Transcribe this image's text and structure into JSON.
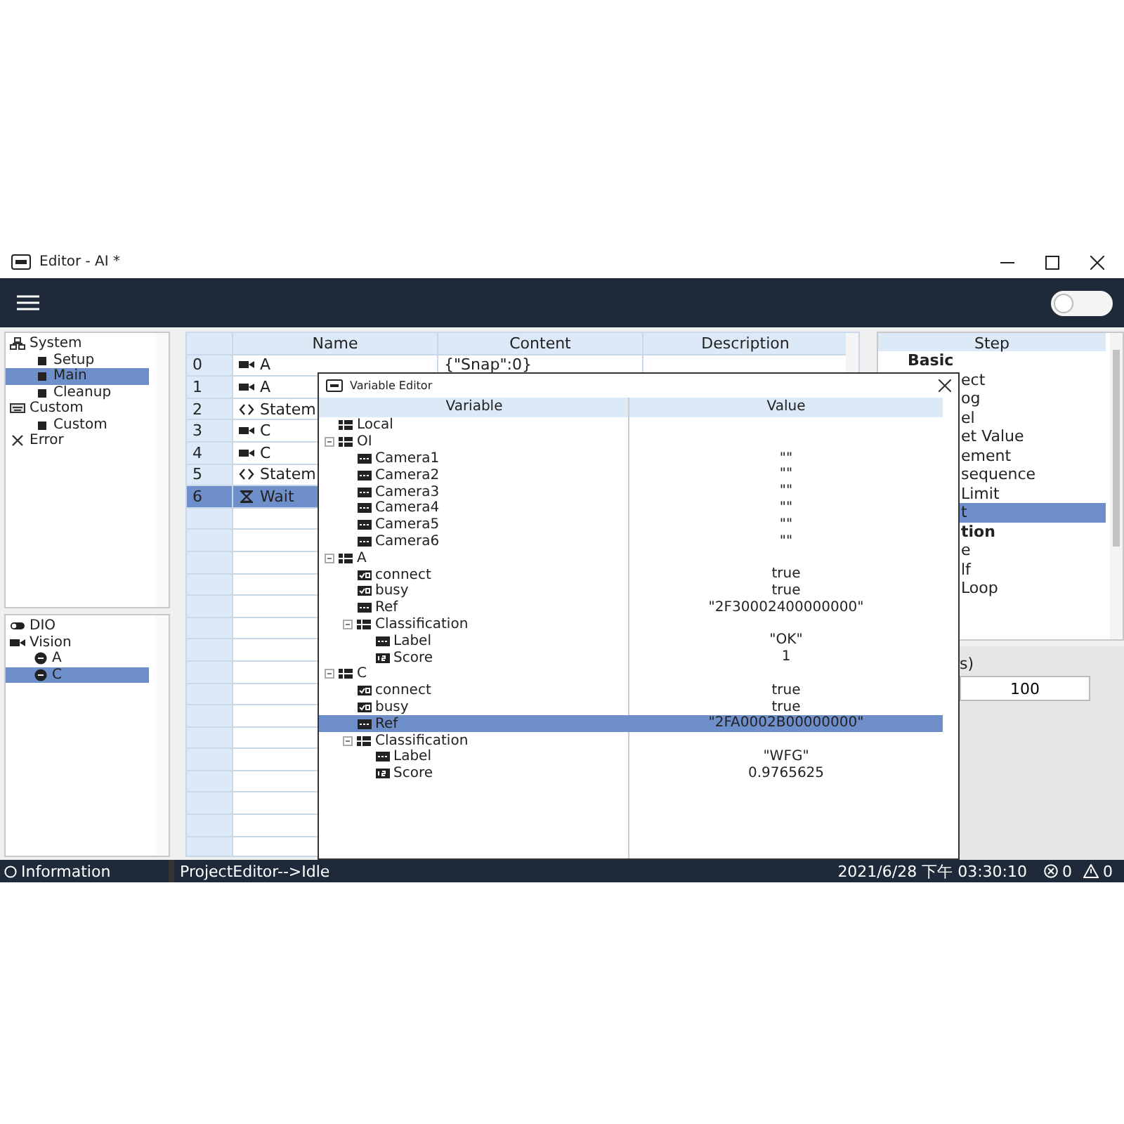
{
  "window": {
    "title": "Editor - AI *"
  },
  "toolbar": {
    "toggle_on": false
  },
  "program_tree": [
    {
      "label": "System",
      "kind": "system",
      "selected": false,
      "children": [
        {
          "label": "Setup",
          "kind": "step",
          "selected": false
        },
        {
          "label": "Main",
          "kind": "step",
          "selected": true
        },
        {
          "label": "Cleanup",
          "kind": "step",
          "selected": false
        }
      ]
    },
    {
      "label": "Custom",
      "kind": "custom",
      "selected": false,
      "children": [
        {
          "label": "Custom",
          "kind": "step",
          "selected": false
        }
      ]
    },
    {
      "label": "Error",
      "kind": "error",
      "selected": false
    }
  ],
  "device_tree": [
    {
      "label": "DIO",
      "kind": "dio",
      "selected": false
    },
    {
      "label": "Vision",
      "kind": "camera",
      "selected": false,
      "children": [
        {
          "label": "A",
          "kind": "device",
          "selected": false
        },
        {
          "label": "C",
          "kind": "device",
          "selected": true
        }
      ]
    }
  ],
  "steps_table": {
    "columns": [
      "Name",
      "Content",
      "Description"
    ],
    "rows": [
      {
        "index": "0",
        "kind": "camera",
        "name": "A",
        "content": "{\"Snap\":0}",
        "selected": false
      },
      {
        "index": "1",
        "kind": "camera",
        "name": "A",
        "selected": false
      },
      {
        "index": "2",
        "kind": "statement",
        "name": "Statem",
        "selected": false
      },
      {
        "index": "3",
        "kind": "camera",
        "name": "C",
        "selected": false
      },
      {
        "index": "4",
        "kind": "camera",
        "name": "C",
        "selected": false
      },
      {
        "index": "5",
        "kind": "statement",
        "name": "Statem",
        "selected": false
      },
      {
        "index": "6",
        "kind": "wait",
        "name": "Wait",
        "selected": true
      }
    ]
  },
  "step_list": {
    "header": "Step",
    "items": [
      {
        "label": "Basic",
        "kind": "group",
        "clipped": false,
        "selected": false
      },
      {
        "label": "ect",
        "kind": "step",
        "clipped": true,
        "selected": false
      },
      {
        "label": "og",
        "kind": "step",
        "clipped": true,
        "selected": false
      },
      {
        "label": "el",
        "kind": "step",
        "clipped": true,
        "selected": false
      },
      {
        "label": "et Value",
        "kind": "step",
        "clipped": true,
        "selected": false
      },
      {
        "label": "ement",
        "kind": "step",
        "clipped": true,
        "selected": false
      },
      {
        "label": "sequence",
        "kind": "step",
        "clipped": true,
        "selected": false
      },
      {
        "label": "Limit",
        "kind": "step",
        "clipped": true,
        "selected": false
      },
      {
        "label": "t",
        "kind": "step",
        "clipped": true,
        "selected": true
      },
      {
        "label": "tion",
        "kind": "group",
        "clipped": true,
        "selected": false
      },
      {
        "label": "e",
        "kind": "step",
        "clipped": true,
        "selected": false
      },
      {
        "label": "lf",
        "kind": "step",
        "clipped": true,
        "selected": false
      },
      {
        "label": "Loop",
        "kind": "step",
        "clipped": true,
        "selected": false
      }
    ]
  },
  "properties": {
    "label": "s)",
    "value": "100"
  },
  "variable_editor": {
    "title": "Variable Editor",
    "columns": [
      "Variable",
      "Value"
    ],
    "tree": [
      {
        "name": "Local",
        "kind": "object",
        "selected": false
      },
      {
        "name": "OI",
        "kind": "object",
        "expanded": true,
        "selected": false,
        "children": [
          {
            "name": "Camera1",
            "kind": "string",
            "value": "\"\"",
            "selected": false
          },
          {
            "name": "Camera2",
            "kind": "string",
            "value": "\"\"",
            "selected": false
          },
          {
            "name": "Camera3",
            "kind": "string",
            "value": "\"\"",
            "selected": false
          },
          {
            "name": "Camera4",
            "kind": "string",
            "value": "\"\"",
            "selected": false
          },
          {
            "name": "Camera5",
            "kind": "string",
            "value": "\"\"",
            "selected": false
          },
          {
            "name": "Camera6",
            "kind": "string",
            "value": "\"\"",
            "selected": false
          }
        ]
      },
      {
        "name": "A",
        "kind": "object",
        "expanded": true,
        "selected": false,
        "children": [
          {
            "name": "connect",
            "kind": "bool",
            "value": "true",
            "selected": false
          },
          {
            "name": "busy",
            "kind": "bool",
            "value": "true",
            "selected": false
          },
          {
            "name": "Ref",
            "kind": "string",
            "value": "\"2F30002400000000\"",
            "selected": false
          },
          {
            "name": "Classification",
            "kind": "object",
            "expanded": true,
            "selected": false,
            "children": [
              {
                "name": "Label",
                "kind": "string",
                "value": "\"OK\"",
                "selected": false
              },
              {
                "name": "Score",
                "kind": "number",
                "value": "1",
                "selected": false
              }
            ]
          }
        ]
      },
      {
        "name": "C",
        "kind": "object",
        "expanded": true,
        "selected": false,
        "children": [
          {
            "name": "connect",
            "kind": "bool",
            "value": "true",
            "selected": false
          },
          {
            "name": "busy",
            "kind": "bool",
            "value": "true",
            "selected": false
          },
          {
            "name": "Ref",
            "kind": "string",
            "value": "\"2FA0002B00000000\"",
            "selected": true
          },
          {
            "name": "Classification",
            "kind": "object",
            "expanded": true,
            "selected": false,
            "children": [
              {
                "name": "Label",
                "kind": "string",
                "value": "\"WFG\"",
                "selected": false
              },
              {
                "name": "Score",
                "kind": "number",
                "value": "0.9765625",
                "selected": false
              }
            ]
          }
        ]
      }
    ]
  },
  "status_bar": {
    "message_type": "Information",
    "message": "ProjectEditor-->Idle",
    "timestamp": "2021/6/28 下午 03:30:10",
    "errors": "0",
    "warnings": "0"
  }
}
